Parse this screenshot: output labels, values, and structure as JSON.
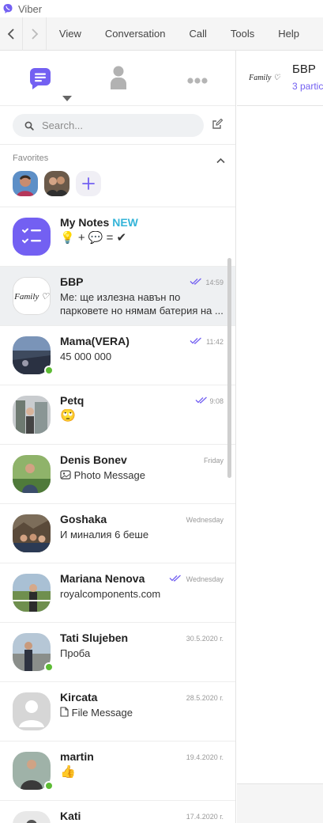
{
  "app": {
    "title": "Viber"
  },
  "menu": [
    "View",
    "Conversation",
    "Call",
    "Tools",
    "Help"
  ],
  "search": {
    "placeholder": "Search..."
  },
  "favorites": {
    "label": "Favorites"
  },
  "chats": [
    {
      "name": "My Notes",
      "badge": "NEW",
      "message_icons": "💡 + 💬 = ✔",
      "time": ""
    },
    {
      "name": "БВР",
      "message": "Me: ще излезна навън по парковете но нямам батерия на ...",
      "time": "14:59",
      "read": true
    },
    {
      "name": "Mama(VERA)",
      "message": "45 000 000",
      "time": "11:42",
      "read": true
    },
    {
      "name": "Petq",
      "message": "🙄",
      "time": "9:08",
      "read": true
    },
    {
      "name": "Denis Bonev",
      "message": "Photo Message",
      "time": "Friday"
    },
    {
      "name": "Goshaka",
      "message": "И миналия 6 беше",
      "time": "Wednesday"
    },
    {
      "name": "Mariana Nenova",
      "message": "royalcomponents.com",
      "time": "Wednesday",
      "read": true
    },
    {
      "name": "Tati Slujeben",
      "message": "Проба",
      "time": "30.5.2020 г."
    },
    {
      "name": "Kircata",
      "message": "File Message",
      "time": "28.5.2020 г."
    },
    {
      "name": "martin",
      "message": "👍",
      "time": "19.4.2020 г."
    },
    {
      "name": "Kati",
      "message": "",
      "time": "17.4.2020 г."
    }
  ],
  "conversation": {
    "title": "БВР",
    "subtitle": "3 partic",
    "logo_text": "Family"
  },
  "colors": {
    "accent": "#7360f2",
    "online": "#5dbb35",
    "new_badge": "#34b4d8"
  }
}
